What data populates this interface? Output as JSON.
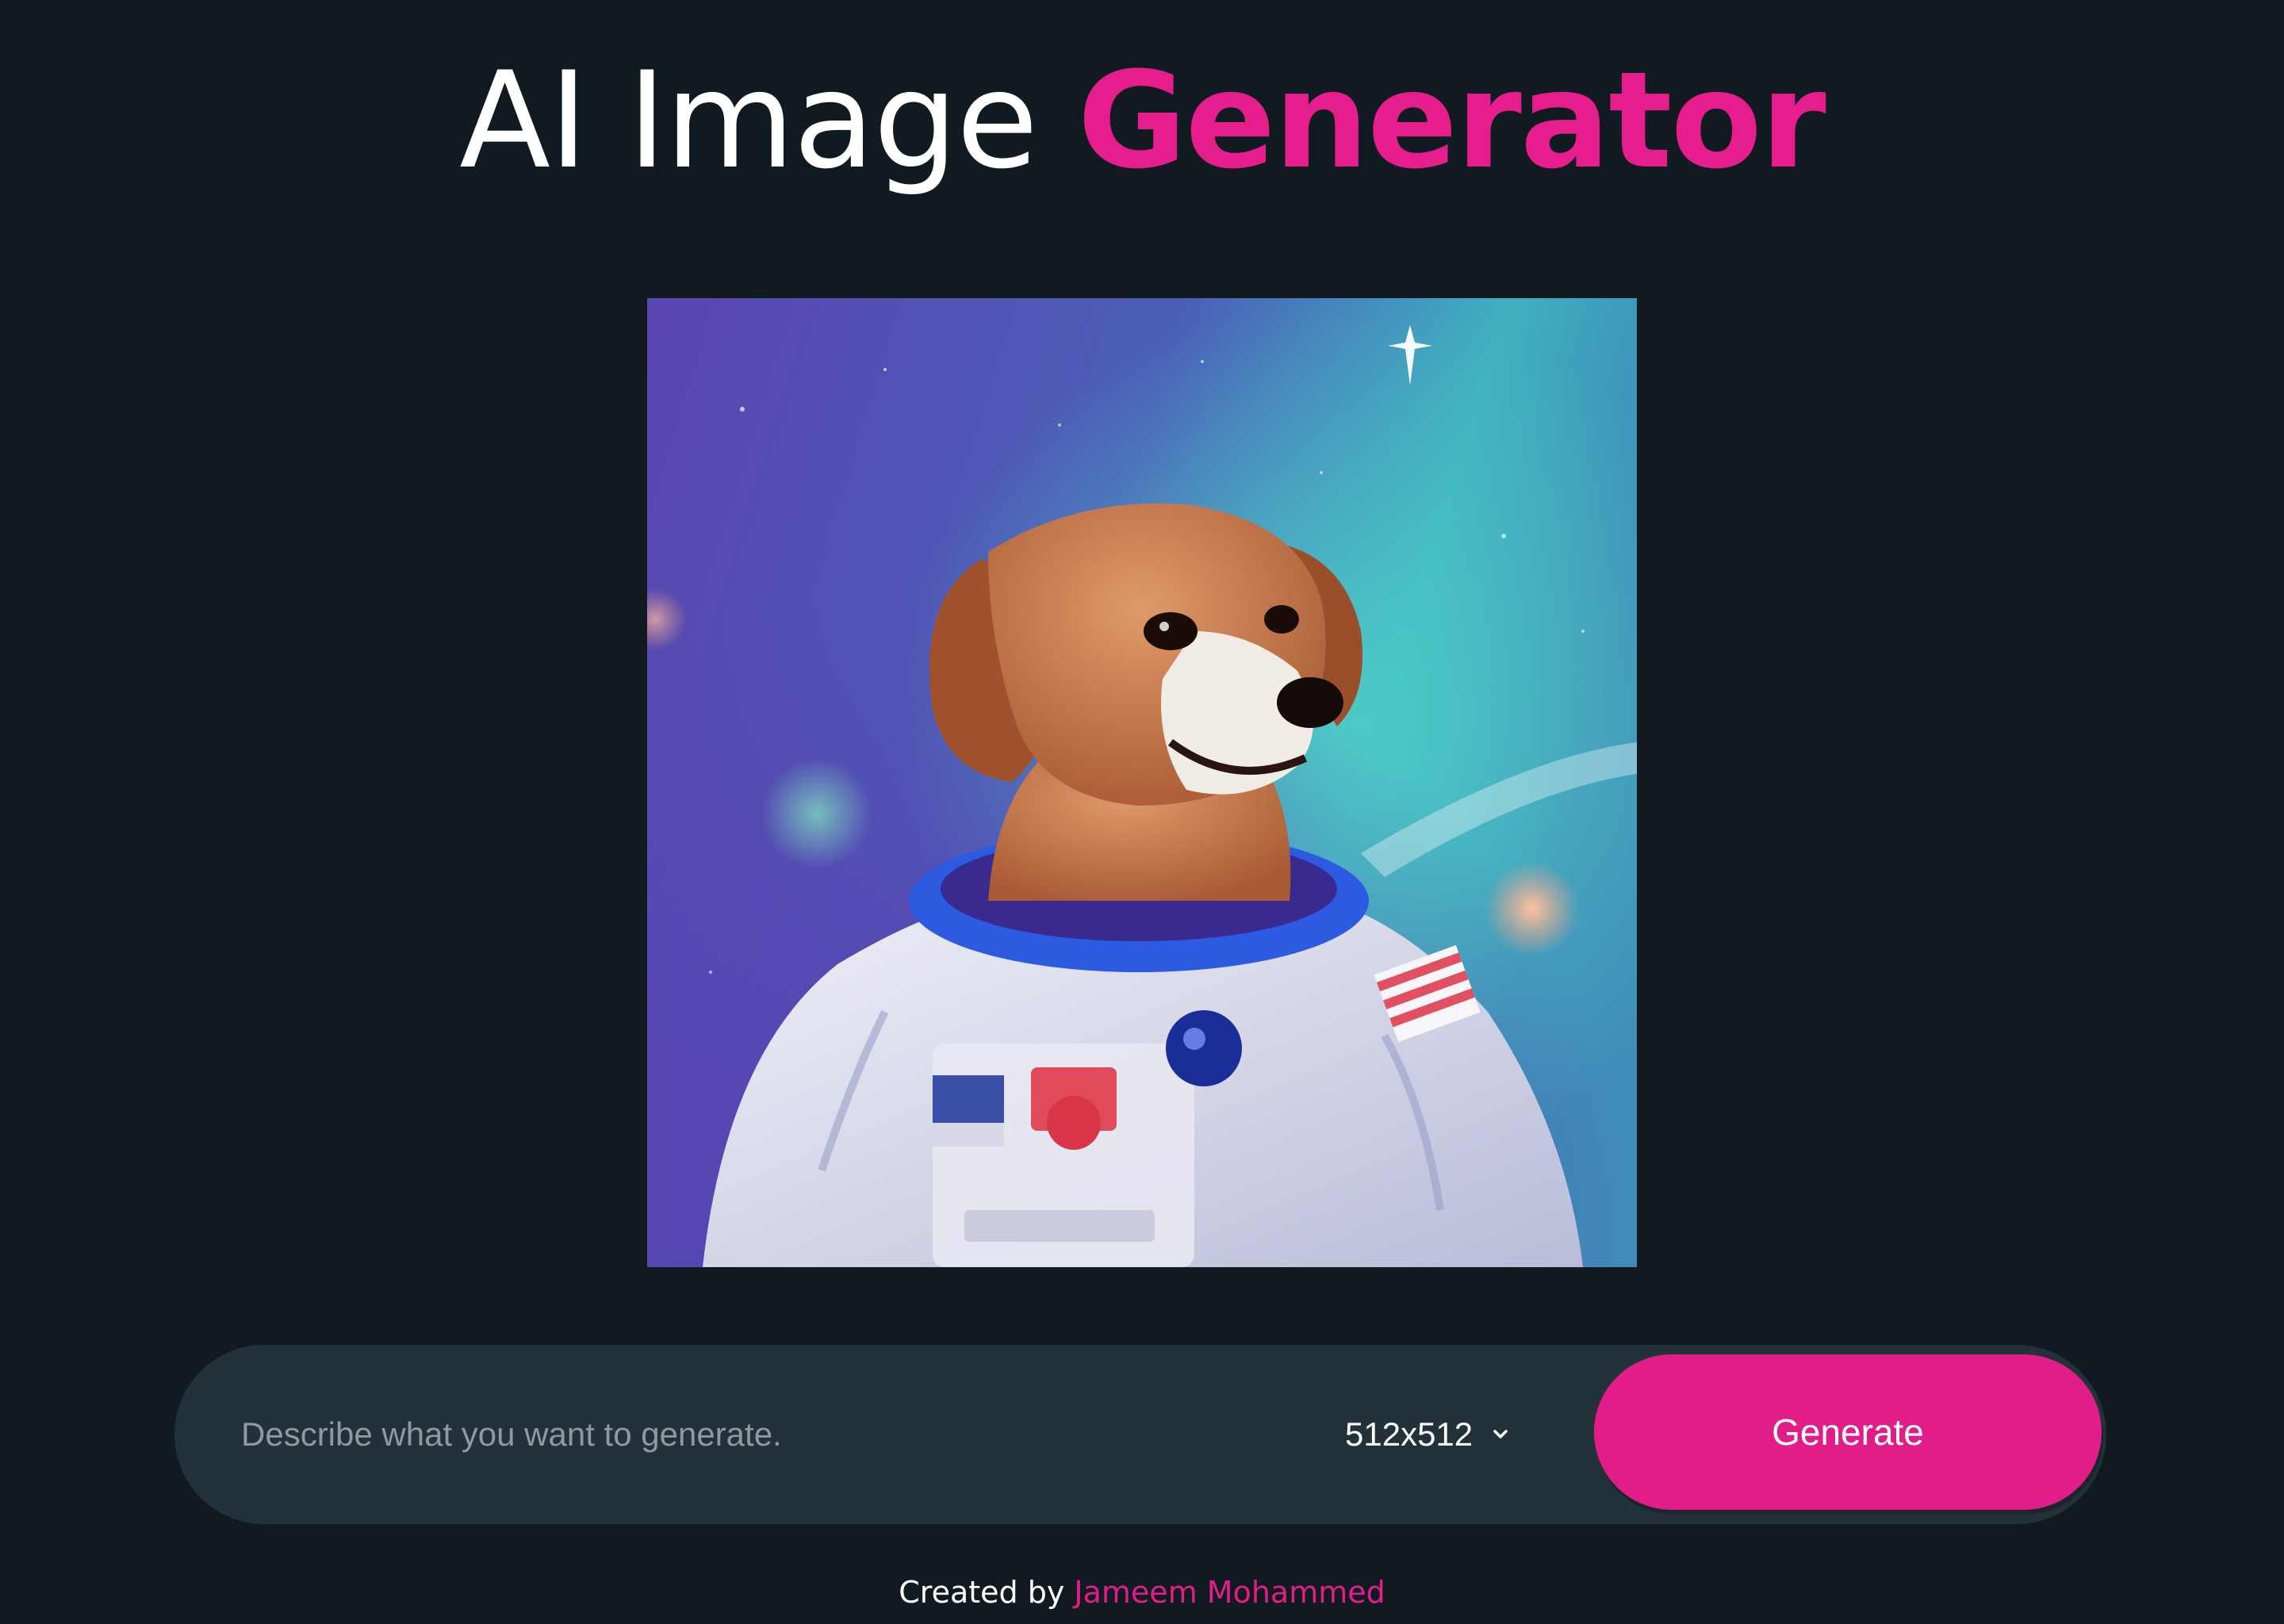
{
  "header": {
    "title_part1": "AI Image",
    "title_part2": "Generator"
  },
  "preview": {
    "image_description": "Portrait of a beagle dog wearing a white astronaut spacesuit with a blue collar ring against a purple and teal nebula starfield"
  },
  "prompt_form": {
    "placeholder": "Describe what you want to generate.",
    "value": "",
    "size_selected": "512x512",
    "generate_label": "Generate"
  },
  "footer": {
    "created_by": "Created by",
    "author": "Jameem Mohammed"
  },
  "colors": {
    "background": "#111a21",
    "accent": "#e11d8a",
    "bar": "#233139"
  }
}
